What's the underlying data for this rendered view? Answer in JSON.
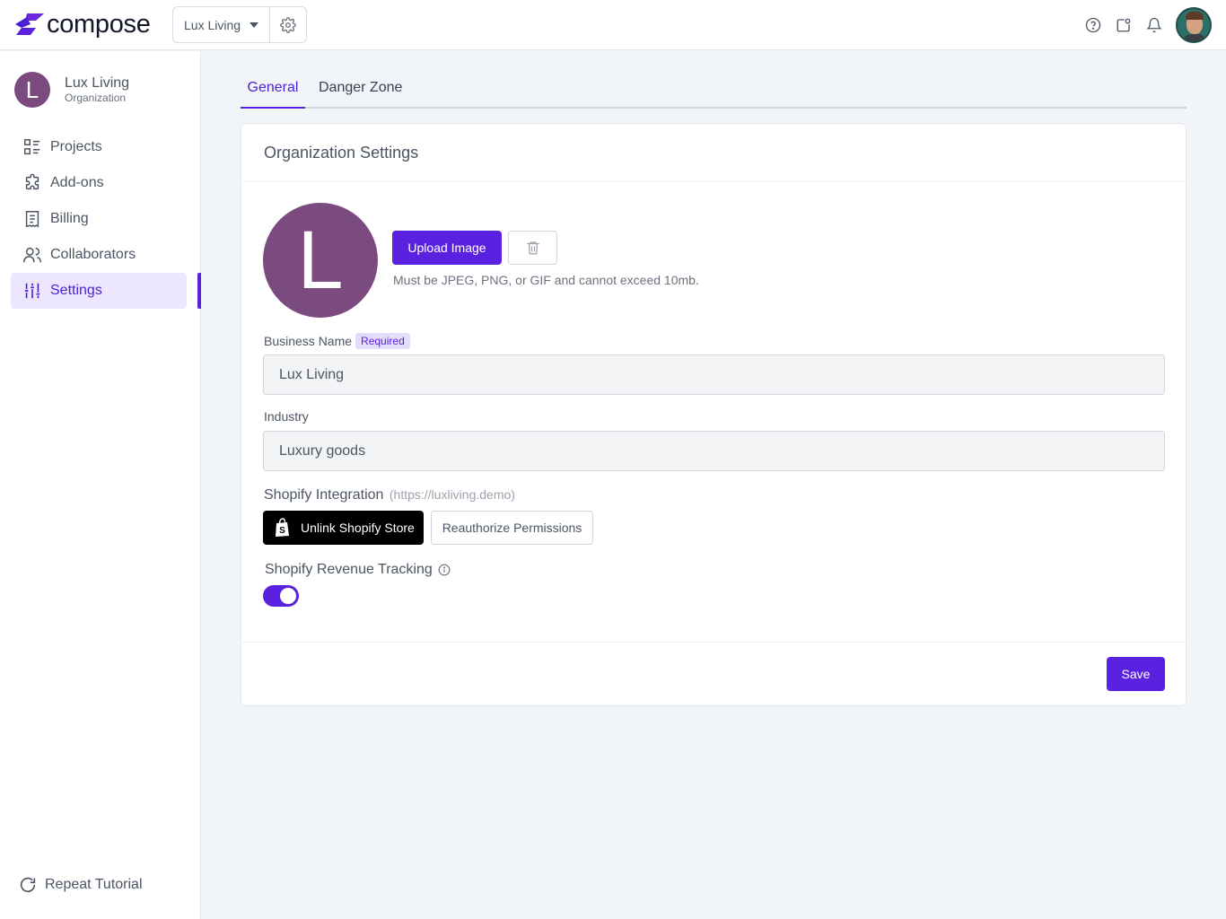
{
  "brand": {
    "name": "compose",
    "accent": "#5b21e0"
  },
  "header": {
    "org_selector": "Lux Living",
    "icons": [
      "help-icon",
      "whats-new-icon",
      "bell-icon"
    ]
  },
  "sidebar": {
    "org": {
      "initial": "L",
      "name": "Lux Living",
      "type": "Organization"
    },
    "items": [
      {
        "label": "Projects",
        "icon": "projects-icon"
      },
      {
        "label": "Add-ons",
        "icon": "puzzle-icon"
      },
      {
        "label": "Billing",
        "icon": "receipt-icon"
      },
      {
        "label": "Collaborators",
        "icon": "users-icon"
      },
      {
        "label": "Settings",
        "icon": "sliders-icon",
        "active": true
      }
    ],
    "footer": "Repeat Tutorial"
  },
  "tabs": [
    {
      "label": "General",
      "active": true
    },
    {
      "label": "Danger Zone",
      "active": false
    }
  ],
  "card": {
    "title": "Organization Settings",
    "avatar_initial": "L",
    "upload_label": "Upload Image",
    "upload_hint": "Must be JPEG, PNG, or GIF and cannot exceed 10mb.",
    "business_name": {
      "label": "Business Name",
      "badge": "Required",
      "value": "Lux Living"
    },
    "industry": {
      "label": "Industry",
      "value": "Luxury goods"
    },
    "shopify": {
      "label": "Shopify Integration",
      "url": "(https://luxliving.demo)",
      "unlink_label": "Unlink Shopify Store",
      "reauth_label": "Reauthorize Permissions"
    },
    "revenue_tracking": {
      "label": "Shopify Revenue Tracking",
      "enabled": true
    },
    "save_label": "Save"
  }
}
